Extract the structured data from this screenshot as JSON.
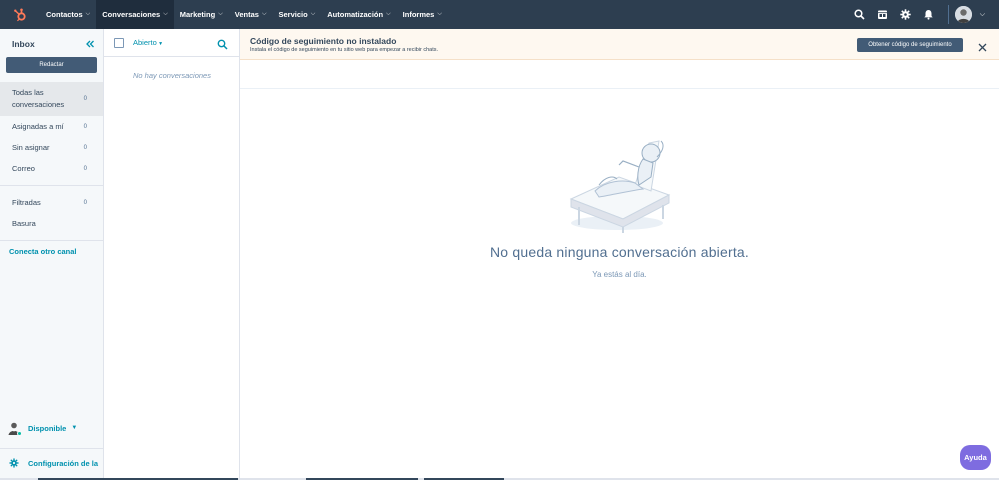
{
  "topnav": {
    "logo": "hubspot-logo",
    "items": [
      {
        "label": "Contactos",
        "active": false
      },
      {
        "label": "Conversaciones",
        "active": true
      },
      {
        "label": "Marketing",
        "active": false
      },
      {
        "label": "Ventas",
        "active": false
      },
      {
        "label": "Servicio",
        "active": false
      },
      {
        "label": "Automatización",
        "active": false
      },
      {
        "label": "Informes",
        "active": false
      }
    ],
    "right_icons": [
      "search-icon",
      "marketplace-icon",
      "gear-icon",
      "bell-icon"
    ]
  },
  "sidebar": {
    "title": "Inbox",
    "compose_label": "Redactar",
    "items": [
      {
        "label": "Todas las conversaciones",
        "count": "0"
      },
      {
        "label": "Asignadas a mí",
        "count": "0"
      },
      {
        "label": "Sin asignar",
        "count": "0"
      },
      {
        "label": "Correo",
        "count": "0"
      },
      {
        "label": "Filtradas",
        "count": "0"
      },
      {
        "label": "Basura",
        "count": ""
      }
    ],
    "channel_link": "Conecta otro canal",
    "availability": "Disponible",
    "settings_label": "Configuración de la"
  },
  "conversations": {
    "filter_label": "Abierto",
    "empty_text": "No hay conversaciones"
  },
  "banner": {
    "title": "Código de seguimiento no instalado",
    "subtitle": "Instala el código de seguimiento en tu sitio web para empezar a recibir chats.",
    "button_label": "Obtener código de seguimiento"
  },
  "empty_state": {
    "title": "No queda ninguna conversación abierta.",
    "subtitle": "Ya estás al día."
  },
  "help_label": "Ayuda",
  "colors": {
    "nav_bg": "#2d3e50",
    "accent_link": "#0091ae",
    "primary_button": "#425b76",
    "help_button": "#7e6ce0",
    "banner_bg": "#fef8f0",
    "logo_orange": "#ff7a59"
  }
}
